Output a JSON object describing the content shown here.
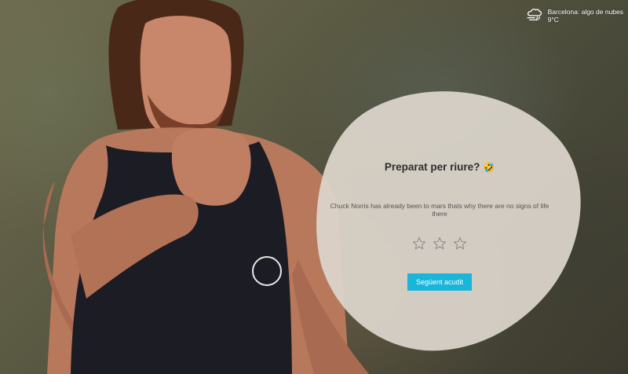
{
  "weather": {
    "icon": "cloud-rain-wind-icon",
    "line1": "Barcelona: algo de nubes",
    "line2": "9°C"
  },
  "card": {
    "title": "Preparat per riure?",
    "title_emoji": "🤣",
    "joke": "Chuck Norris has already been to mars thats why there are no signs of life there",
    "rating": 0,
    "max_rating": 3,
    "next_button": "Següent acudit"
  },
  "colors": {
    "card_bg": "#ddd6cc",
    "button_bg": "#1ab6d9",
    "star_stroke": "#888888"
  }
}
